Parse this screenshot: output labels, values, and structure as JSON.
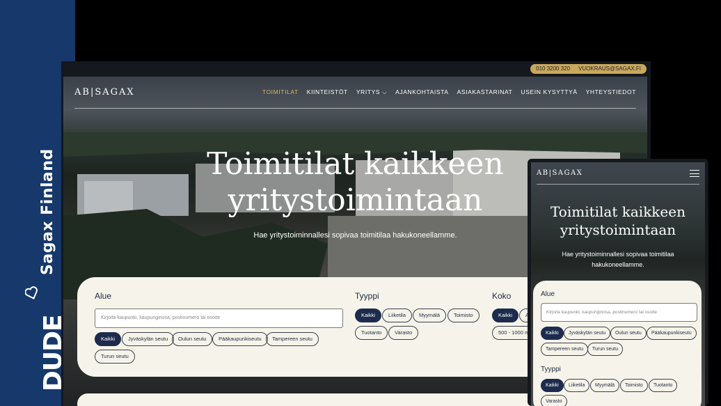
{
  "sidebar": {
    "brand_title": "Sagax Finland",
    "agency_logo": "DUDE",
    "heart_icon": "heart-icon",
    "background": "#16386a"
  },
  "desktop": {
    "contact": {
      "phone": "010 3200 320",
      "email": "VUOKRAUS@SAGAX.FI"
    },
    "logo": "AB|SAGAX",
    "menu": [
      "TOIMITILAT",
      "KIINTEISTÖT",
      "YRITYS ⌵",
      "AJANKOHTAISTA",
      "ASIAKASTARINAT",
      "USEIN KYSYTTYÄ",
      "YHTEYSTIEDOT"
    ],
    "hero_title_line1": "Toimitilat kaikkeen",
    "hero_title_line2": "yritystoimintaan",
    "hero_subtitle": "Hae yritystoiminnallesi sopivaa toimitilaa hakukoneellamme.",
    "search": {
      "area_label": "Alue",
      "placeholder": "Kirjoita kaupunki, kaupunginosa, postinumero tai osoite",
      "area_chips": [
        "Kaikki",
        "Jyväskylän seutu",
        "Oulun seutu",
        "Pääkaupunkiseutu",
        "Tampereen seutu",
        "Turun seutu"
      ],
      "type_label": "Tyyppi",
      "type_chips": [
        "Kaikki",
        "Liiketila",
        "Myymälä",
        "Toimisto",
        "Tuotanto",
        "Varasto"
      ],
      "size_label": "Koko",
      "size_chips": [
        "Kaikki",
        "A",
        "500 - 1000 m"
      ]
    }
  },
  "mobile": {
    "logo": "AB|SAGAX",
    "hero_title_line1": "Toimitilat kaikkeen",
    "hero_title_line2": "yritystoimintaan",
    "hero_subtitle": "Hae yritystoiminnallesi sopivaa toimitilaa hakukoneellamme.",
    "area_label": "Alue",
    "placeholder": "Kirjoita kaupunki, kaupunginosa, postinumero tai osoite",
    "area_chips": [
      "Kaikki",
      "Jyväskylän seutu",
      "Oulun seutu",
      "Pääkaupunkiseutu",
      "Tampereen seutu",
      "Turun seutu"
    ],
    "type_label": "Tyyppi",
    "type_chips": [
      "Kaikki",
      "Liiketila",
      "Myymälä",
      "Toimisto",
      "Tuotanto",
      "Varasto"
    ]
  },
  "colors": {
    "accent_gold": "#c9a85a",
    "navy": "#1d2b4d",
    "panel": "#f6f4ea"
  }
}
